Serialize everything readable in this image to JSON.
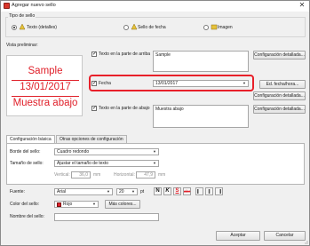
{
  "window": {
    "title": "Agregar nuevo sello",
    "close_glyph": "✕"
  },
  "tipo_sello": {
    "label": "Tipo de sello",
    "options": [
      {
        "label": "Texto (detalles)",
        "selected": true
      },
      {
        "label": "Sello de fecha",
        "selected": false
      },
      {
        "label": "Imagen",
        "selected": false
      }
    ]
  },
  "preview": {
    "label": "Vista preliminar:",
    "line1": "Sample",
    "line2": "13/01/2017",
    "line3": "Muestra abajo",
    "stamp_color": "#e0202a"
  },
  "texto_arriba": {
    "label": "Texto en la parte de arriba",
    "checked": true,
    "value": "Sample",
    "button": "Configuración detallada..."
  },
  "fecha": {
    "label": "Fecha",
    "checked": true,
    "value": "13/01/2017",
    "button": "Ed. fecha/hora...",
    "button2": "Configuración detallada..."
  },
  "texto_abajo": {
    "label": "Texto en la parte de abajo",
    "checked": true,
    "value": "Muestra abajo",
    "button": "Configuración detallada..."
  },
  "tabs": [
    {
      "label": "Configuración básica",
      "active": true
    },
    {
      "label": "Otras opciones de configuración",
      "active": false
    }
  ],
  "basic": {
    "borde_label": "Borde del sello:",
    "borde_value": "Cuadro redondo",
    "tamano_label": "Tamaño de sello:",
    "tamano_value": "Ajustar el tamaño de texto",
    "vertical_label": "Vertical:",
    "vertical_value": "36,0",
    "vertical_unit": "mm",
    "horizontal_label": "Horizontal:",
    "horizontal_value": "47,9",
    "horizontal_unit": "mm",
    "fuente_label": "Fuente:",
    "fuente_value": "Arial",
    "size_value": "20",
    "size_unit": "pt",
    "bold": "N",
    "italic": "K",
    "underline": "S",
    "strike": "abc",
    "color_label": "Color del sello:",
    "color_value": "Rojo",
    "more_colors": "Más colores..."
  },
  "nombre": {
    "label": "Nombre del sello:",
    "value": ""
  },
  "footer": {
    "ok": "Aceptar",
    "cancel": "Cancelar"
  }
}
